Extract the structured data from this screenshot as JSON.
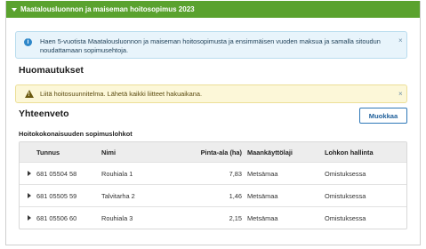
{
  "panel": {
    "title": "Maatalousluonnon ja maiseman hoitosopimus 2023"
  },
  "info_alert": {
    "icon": "info-icon",
    "text": "Haen 5-vuotista Maatalousluonnon ja maiseman hoitosopimusta ja ensimmäisen vuoden maksua ja samalla sitoudun noudattamaan sopimusehtoja.",
    "close": "×"
  },
  "remarks": {
    "heading": "Huomautukset",
    "warning_icon": "warning-icon",
    "warning_text": "Liitä hoitosuunnitelma. Lähetä kaikki liitteet hakuaikana.",
    "close": "×"
  },
  "summary": {
    "heading": "Yhteenveto",
    "edit_label": "Muokkaa",
    "subtitle": "Hoitokokonaisuuden sopimuslohkot"
  },
  "table": {
    "columns": [
      "Tunnus",
      "Nimi",
      "Pinta-ala (ha)",
      "Maankäyttölaji",
      "Lohkon hallinta"
    ],
    "rows": [
      {
        "tunnus": "681 05504 58",
        "nimi": "Rouhiala 1",
        "pinta_ala": "7,83",
        "maankaytto": "Metsämaa",
        "hallinta": "Omistuksessa"
      },
      {
        "tunnus": "681 05505 59",
        "nimi": "Talvitarha 2",
        "pinta_ala": "1,46",
        "maankaytto": "Metsämaa",
        "hallinta": "Omistuksessa"
      },
      {
        "tunnus": "681 05506 60",
        "nimi": "Rouhiala 3",
        "pinta_ala": "2,15",
        "maankaytto": "Metsämaa",
        "hallinta": "Omistuksessa"
      }
    ]
  },
  "colors": {
    "header_green": "#5aa22e",
    "info_bg": "#e8f4fb",
    "warning_bg": "#fcf7d8",
    "button_blue": "#2f78b8"
  }
}
